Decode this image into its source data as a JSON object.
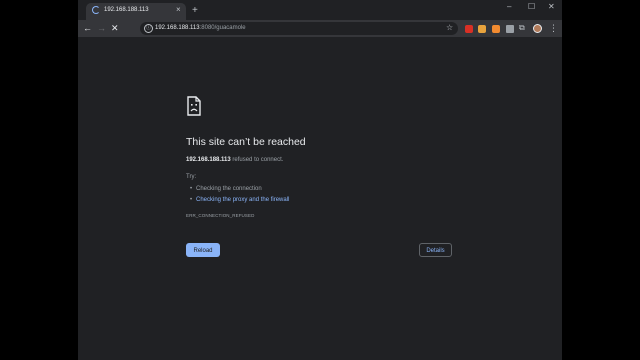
{
  "tab": {
    "title": "192.168.188.113",
    "close": "×"
  },
  "new_tab": "+",
  "window_controls": {
    "minimize": "–",
    "maximize": "☐",
    "close": "✕"
  },
  "nav": {
    "back": "←",
    "forward": "→",
    "stop": "✕"
  },
  "omnibox": {
    "host": "192.168.188.113",
    "rest": ":8080/guacamole",
    "info_icon": "ⓘ",
    "star": "☆"
  },
  "extensions": [
    "red-extension-icon",
    "orange-extension-icon",
    "amber-extension-icon",
    "grey-extension-icon"
  ],
  "toolbar_right": {
    "puzzle": "⧉",
    "menu": "⋮"
  },
  "error": {
    "title": "This site can’t be reached",
    "host": "192.168.188.113",
    "host_suffix": " refused to connect.",
    "try_label": "Try:",
    "suggestions": [
      "Checking the connection",
      "Checking the proxy and the firewall"
    ],
    "code": "ERR_CONNECTION_REFUSED",
    "reload_label": "Reload",
    "details_label": "Details"
  },
  "colors": {
    "background": "#202124",
    "toolbar": "#35363a",
    "accent": "#8ab4f8",
    "text": "#e8eaed",
    "muted": "#9aa0a6"
  }
}
